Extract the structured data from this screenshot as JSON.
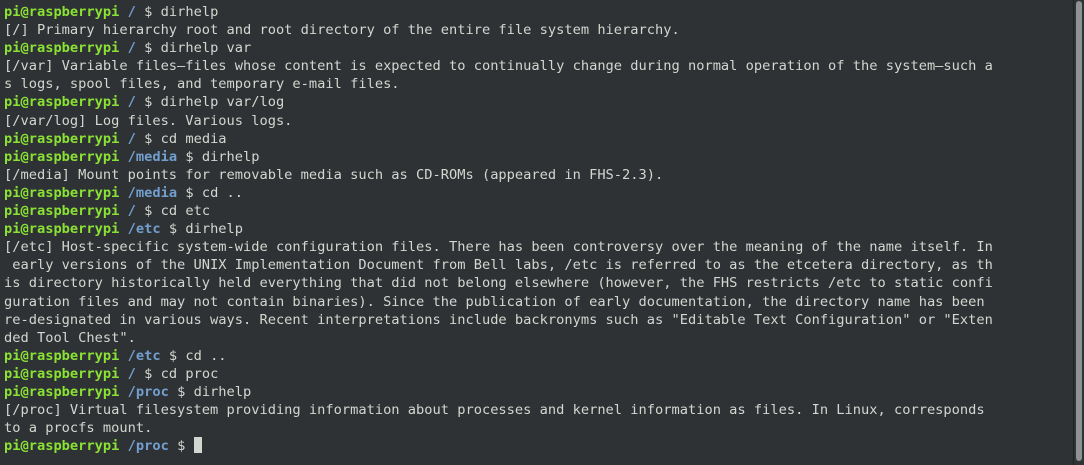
{
  "prompt": {
    "user": "pi@raspberrypi",
    "sep": "$"
  },
  "lines": [
    {
      "type": "prompt",
      "path": "/",
      "cmd": "dirhelp"
    },
    {
      "type": "out",
      "text": "[/] Primary hierarchy root and root directory of the entire file system hierarchy."
    },
    {
      "type": "prompt",
      "path": "/",
      "cmd": "dirhelp var"
    },
    {
      "type": "out",
      "text": "[/var] Variable files—files whose content is expected to continually change during normal operation of the system—such a"
    },
    {
      "type": "out",
      "text": "s logs, spool files, and temporary e-mail files."
    },
    {
      "type": "prompt",
      "path": "/",
      "cmd": "dirhelp var/log"
    },
    {
      "type": "out",
      "text": "[/var/log] Log files. Various logs."
    },
    {
      "type": "prompt",
      "path": "/",
      "cmd": "cd media"
    },
    {
      "type": "prompt",
      "path": "/media",
      "cmd": "dirhelp"
    },
    {
      "type": "out",
      "text": "[/media] Mount points for removable media such as CD-ROMs (appeared in FHS-2.3)."
    },
    {
      "type": "prompt",
      "path": "/media",
      "cmd": "cd .."
    },
    {
      "type": "prompt",
      "path": "/",
      "cmd": "cd etc"
    },
    {
      "type": "prompt",
      "path": "/etc",
      "cmd": "dirhelp"
    },
    {
      "type": "out",
      "text": "[/etc] Host-specific system-wide configuration files. There has been controversy over the meaning of the name itself. In"
    },
    {
      "type": "out",
      "text": " early versions of the UNIX Implementation Document from Bell labs, /etc is referred to as the etcetera directory, as th"
    },
    {
      "type": "out",
      "text": "is directory historically held everything that did not belong elsewhere (however, the FHS restricts /etc to static confi"
    },
    {
      "type": "out",
      "text": "guration files and may not contain binaries). Since the publication of early documentation, the directory name has been"
    },
    {
      "type": "out",
      "text": "re-designated in various ways. Recent interpretations include backronyms such as \"Editable Text Configuration\" or \"Exten"
    },
    {
      "type": "out",
      "text": "ded Tool Chest\"."
    },
    {
      "type": "prompt",
      "path": "/etc",
      "cmd": "cd .."
    },
    {
      "type": "prompt",
      "path": "/",
      "cmd": "cd proc"
    },
    {
      "type": "prompt",
      "path": "/proc",
      "cmd": "dirhelp"
    },
    {
      "type": "out",
      "text": "[/proc] Virtual filesystem providing information about processes and kernel information as files. In Linux, corresponds"
    },
    {
      "type": "out",
      "text": "to a procfs mount."
    },
    {
      "type": "prompt",
      "path": "/proc",
      "cmd": "",
      "cursor": true
    }
  ],
  "colors": {
    "background": "#2f3235",
    "text": "#d3d7cf",
    "user": "#8ae234",
    "path": "#729fcf"
  }
}
